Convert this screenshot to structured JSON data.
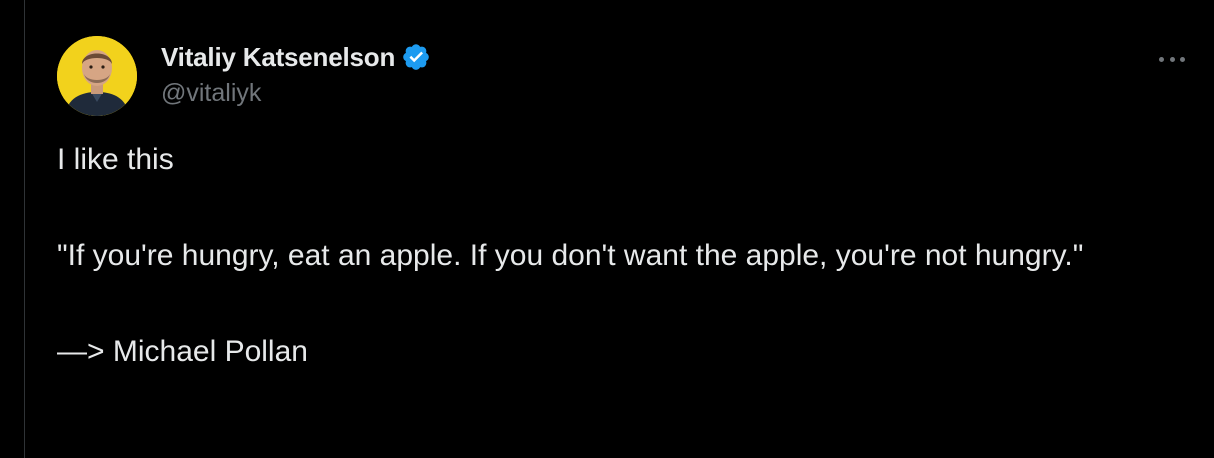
{
  "author": {
    "display_name": "Vitaliy Katsenelson",
    "handle": "@vitaliyk",
    "verified_icon": "verified-badge-icon",
    "avatar_bg": "#f2d21c"
  },
  "tweet": {
    "line1": "I like this",
    "line2": "\"If you're hungry, eat an apple. If you don't want the apple, you're not hungry.\"",
    "line3": "—> Michael Pollan"
  },
  "menu": {
    "icon": "more-horizontal-icon"
  },
  "colors": {
    "background": "#000000",
    "text_primary": "#e7e9ea",
    "text_secondary": "#71767b",
    "verified_blue": "#1d9bf0"
  }
}
